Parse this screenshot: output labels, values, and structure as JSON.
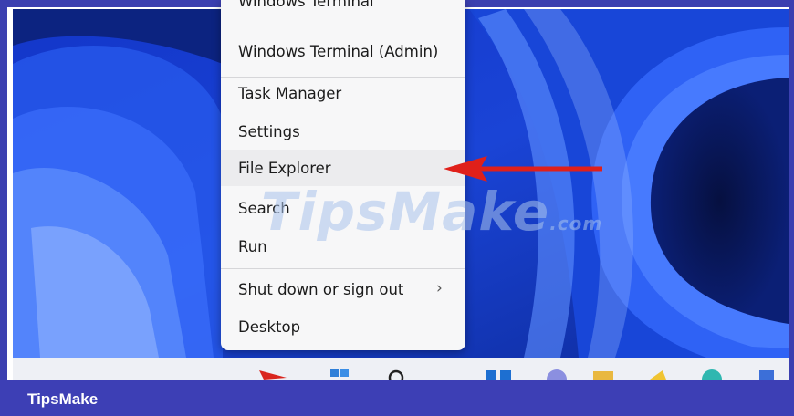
{
  "context_menu": {
    "items": [
      {
        "label": "Windows Terminal"
      },
      {
        "label": "Windows Terminal (Admin)"
      },
      {
        "label": "Task Manager"
      },
      {
        "label": "Settings"
      },
      {
        "label": "File Explorer",
        "highlighted": true
      },
      {
        "label": "Search"
      },
      {
        "label": "Run"
      },
      {
        "label": "Shut down or sign out",
        "has_submenu": true
      },
      {
        "label": "Desktop"
      }
    ]
  },
  "annotation": {
    "arrow_color": "#e0201a",
    "points_to": "File Explorer"
  },
  "watermark": {
    "text": "TipsMake",
    "suffix": ".com"
  },
  "footer": {
    "label": "TipsMake",
    "color": "#3d3fb5"
  },
  "colors": {
    "wallpaper_dark": "#0a1a5e",
    "wallpaper_bright": "#1e4be0",
    "menu_bg": "#f7f7f8"
  },
  "taskbar_icons": [
    "start-icon",
    "search-icon",
    "task-view-icon",
    "widgets-icon",
    "folder-icon",
    "store-icon",
    "edge-icon",
    "calendar-icon"
  ]
}
